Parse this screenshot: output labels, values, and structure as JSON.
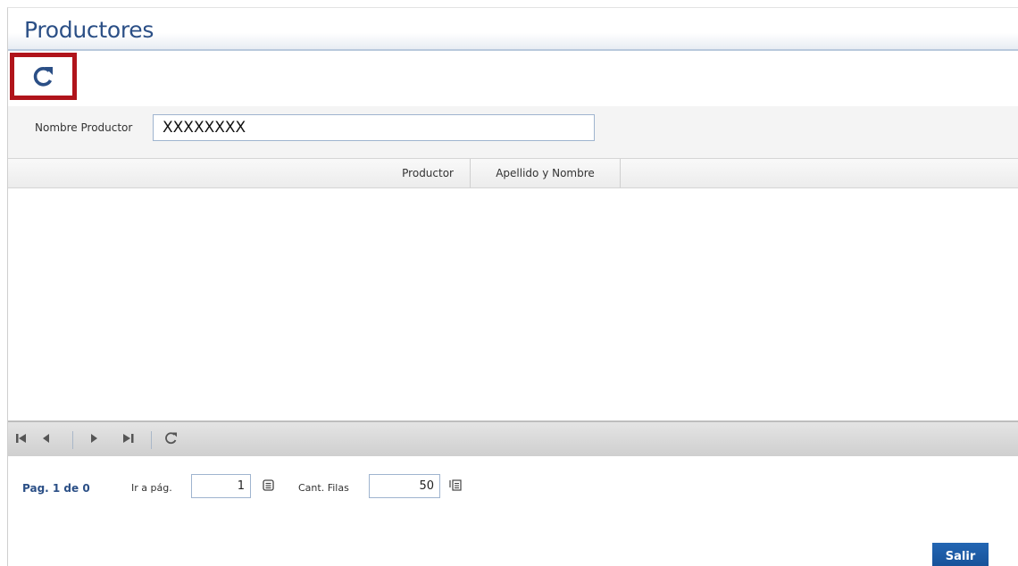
{
  "page": {
    "title": "Productores"
  },
  "filter": {
    "label": "Nombre Productor",
    "value": "XXXXXXXX"
  },
  "grid": {
    "columns": [
      "Productor",
      "Apellido y Nombre"
    ],
    "rows": []
  },
  "pager": {
    "page_info": "Pag. 1 de 0",
    "goto_label": "Ir a pág.",
    "goto_value": "1",
    "rows_label": "Cant. Filas",
    "rows_value": "50"
  },
  "actions": {
    "exit_label": "Salir"
  },
  "icons": {
    "refresh": "refresh-icon",
    "first": "first-page-icon",
    "prev": "prev-page-icon",
    "next": "next-page-icon",
    "last": "last-page-icon",
    "reload": "reload-icon",
    "goto": "goto-page-icon",
    "rows": "rows-per-page-icon"
  },
  "colors": {
    "title": "#2b4f86",
    "highlight_border": "#b0141b",
    "exit_button": "#1b5ca6"
  }
}
